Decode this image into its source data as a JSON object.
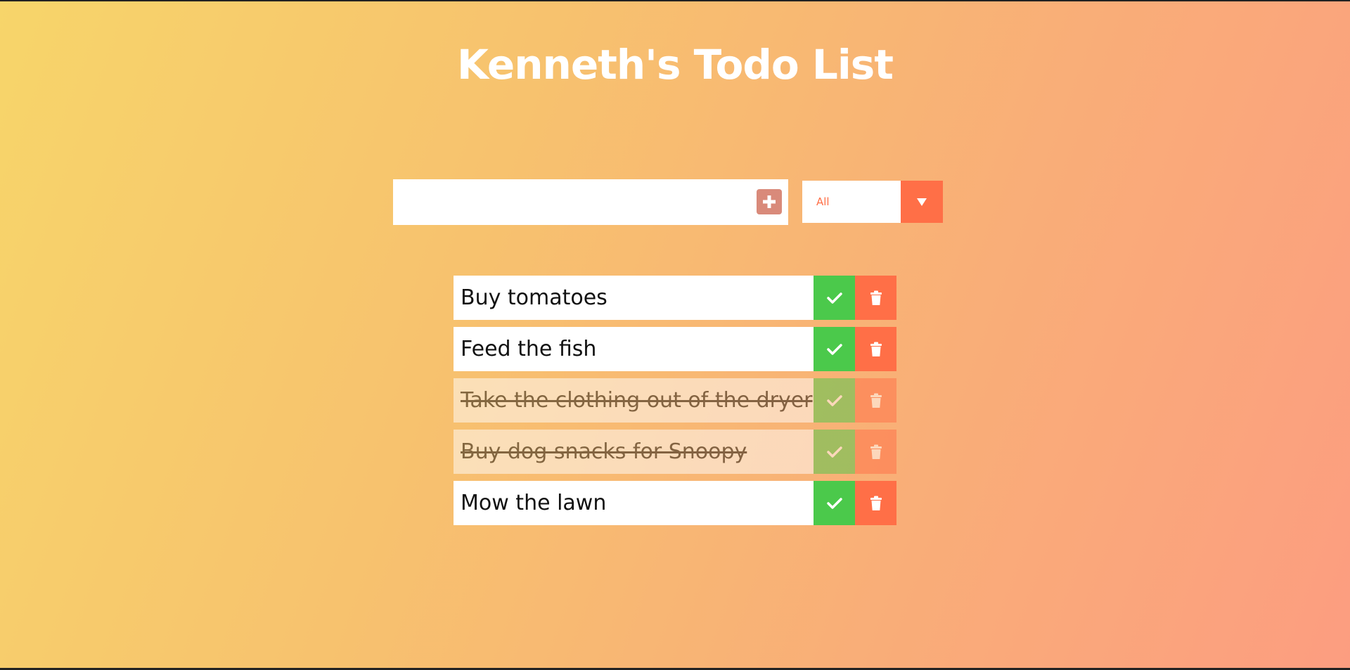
{
  "page": {
    "title": "Kenneth's Todo List"
  },
  "add_form": {
    "input_value": "",
    "placeholder": "",
    "add_icon": "plus-icon"
  },
  "filter": {
    "selected": "All",
    "arrow_icon": "triangle-down-icon"
  },
  "todos": [
    {
      "text": "Buy tomatoes",
      "completed": false
    },
    {
      "text": "Feed the fish",
      "completed": false
    },
    {
      "text": "Take the clothing out of the dryer",
      "completed": true
    },
    {
      "text": "Buy dog snacks for Snoopy",
      "completed": true
    },
    {
      "text": "Mow the lawn",
      "completed": false
    }
  ],
  "todo_actions": {
    "complete_icon": "check-icon",
    "delete_icon": "trash-icon"
  },
  "colors": {
    "accent": "#ff6f47",
    "complete": "#4bc94b",
    "add_button": "#d98a7a",
    "background_start": "#f7d56a",
    "background_end": "#fc9d80"
  }
}
